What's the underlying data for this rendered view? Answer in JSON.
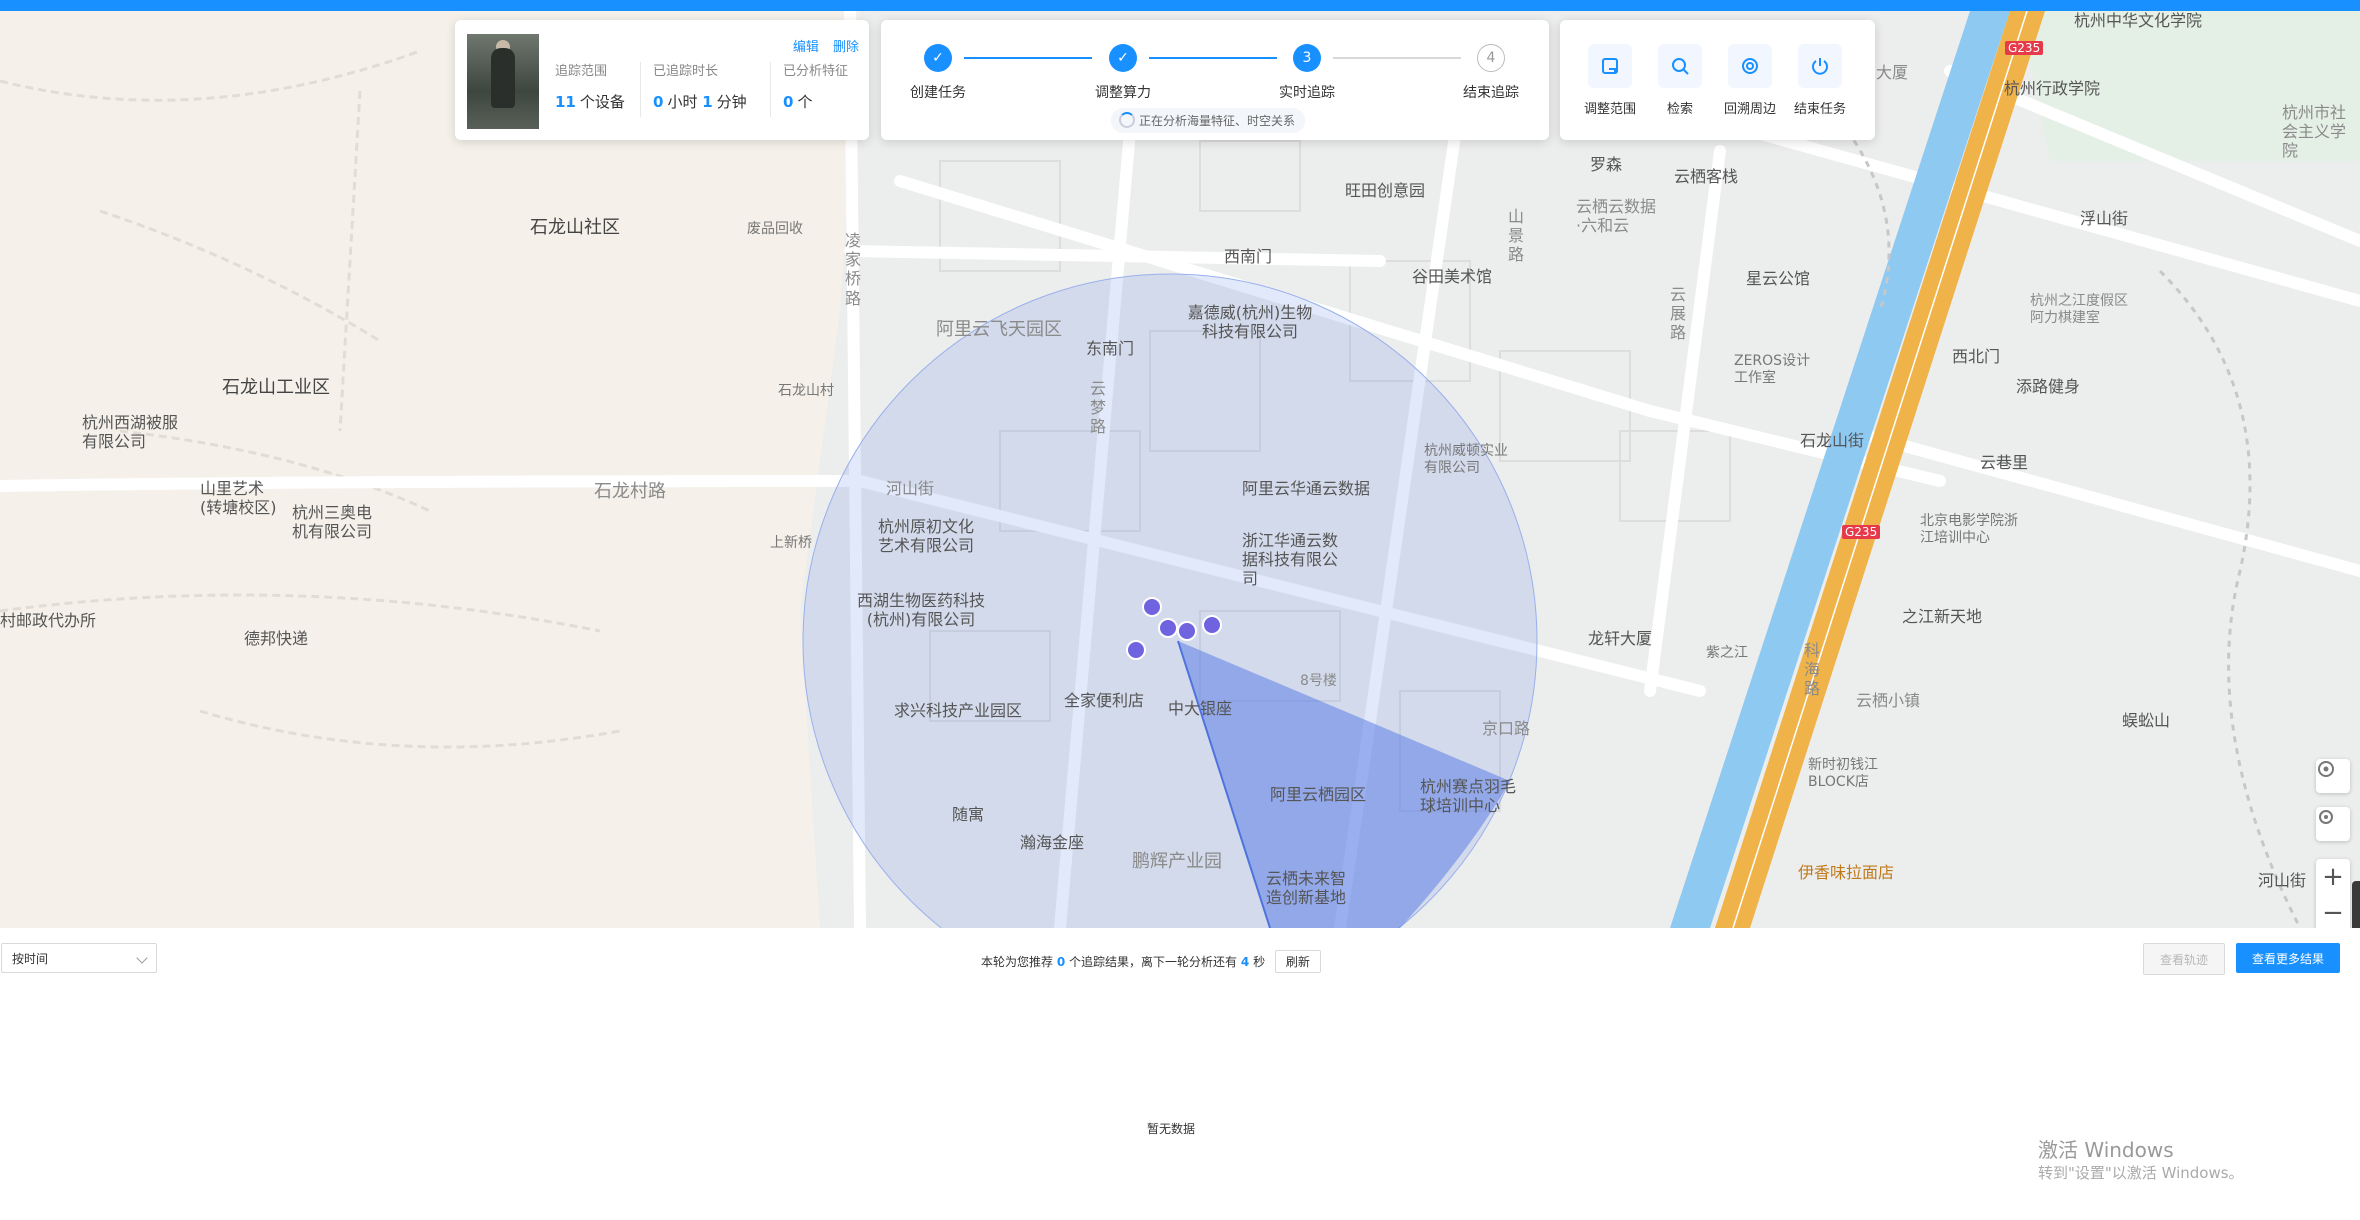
{
  "tracking_panel": {
    "edit_label": "编辑",
    "delete_label": "删除",
    "range_label": "追踪范围",
    "range_value": "11",
    "range_unit": "个设备",
    "duration_label": "已追踪时长",
    "duration_hours": "0",
    "duration_hours_unit": "小时",
    "duration_minutes": "1",
    "duration_minutes_unit": "分钟",
    "features_label": "已分析特征",
    "features_value": "0",
    "features_unit": "个"
  },
  "steps": [
    {
      "label": "创建任务",
      "state": "done",
      "symbol": "✓"
    },
    {
      "label": "调整算力",
      "state": "done",
      "symbol": "✓"
    },
    {
      "label": "实时追踪",
      "state": "current",
      "symbol": "3"
    },
    {
      "label": "结束追踪",
      "state": "todo",
      "symbol": "4"
    }
  ],
  "status_text": "正在分析海量特征、时空关系",
  "tools": [
    {
      "label": "调整范围",
      "icon": "adjust-range-icon"
    },
    {
      "label": "检索",
      "icon": "search-icon"
    },
    {
      "label": "回溯周边",
      "icon": "trace-back-icon"
    },
    {
      "label": "结束任务",
      "icon": "power-icon"
    }
  ],
  "map_labels": {
    "l1": "石龙山社区",
    "l2": "废品回收",
    "l3": "石龙山工业区",
    "l4": "杭州西湖被服有限公司",
    "l5": "山里艺术(转塘校区)",
    "l6": "杭州三奥电机有限公司",
    "l7": "村邮政代办所",
    "l8": "德邦快递",
    "l9": "石龙村路",
    "l10": "石龙山村",
    "l11": "上新桥",
    "l12": "凌家桥路",
    "l13": "河山街",
    "l14": "阿里云飞天园区",
    "l15": "东南门",
    "l16": "西南门",
    "l17": "嘉德威(杭州)生物科技有限公司",
    "l18": "谷田美术馆",
    "l19": "旺田创意园",
    "l20": "云栖客栈",
    "l21": "罗森",
    "l22": "云栖云数据·六和云",
    "l23": "星云公馆",
    "l24": "ZEROS设计工作室",
    "l25": "杭州威顿实业有限公司",
    "l26": "阿里云华通云数据",
    "l27": "浙江华通云数据科技有限公司",
    "l28": "杭州原初文化艺术有限公司",
    "l29": "西湖生物医药科技(杭州)有限公司",
    "l30": "全家便利店",
    "l31": "中大银座",
    "l32": "求兴科技产业园区",
    "l33": "8号楼",
    "l34": "阿里云栖园区",
    "l35": "杭州赛点羽毛球培训中心",
    "l36": "随寓",
    "l37": "瀚海金座",
    "l38": "鹏辉产业园",
    "l39": "云栖未来智造创新基地",
    "l40": "龙轩大厦",
    "l41": "紫之江",
    "l42": "之江新天地",
    "l43": "云栖小镇",
    "l44": "新时初钱江BLOCK店",
    "l45": "伊香味拉面店",
    "l46": "杭州中华文化学院",
    "l47": "杭州行政学院",
    "l48": "大厦",
    "l49": "杭州市社会主义学院",
    "l50": "浮山街",
    "l51": "杭州之江度假区阿力棋建室",
    "l52": "西北门",
    "l53": "添路健身",
    "l54": "云巷里",
    "l55": "北京电影学院浙江培训中心",
    "l56": "石龙山街",
    "l57": "蜈蚣山",
    "l58": "河山街",
    "l59": "科海路",
    "l60": "云梦路",
    "l61": "山景路",
    "l62": "云展路",
    "l63": "京口路",
    "l64": "G235",
    "l65": "G235"
  },
  "bottom": {
    "sort_value": "按时间",
    "info_prefix": "本轮为您推荐",
    "info_count": "0",
    "info_mid": "个追踪结果，离下一轮分析还有",
    "info_seconds": "4",
    "info_suffix": "秒",
    "refresh_label": "刷新",
    "view_track_label": "查看轨迹",
    "view_more_label": "查看更多结果",
    "empty_text": "暂无数据"
  },
  "watermark": {
    "title": "激活 Windows",
    "subtitle": "转到\"设置\"以激活 Windows。"
  },
  "colors": {
    "accent": "#1890ff",
    "highway": "#f0b34a",
    "river": "#8ec9f2",
    "circle": "#6f8fe8"
  }
}
